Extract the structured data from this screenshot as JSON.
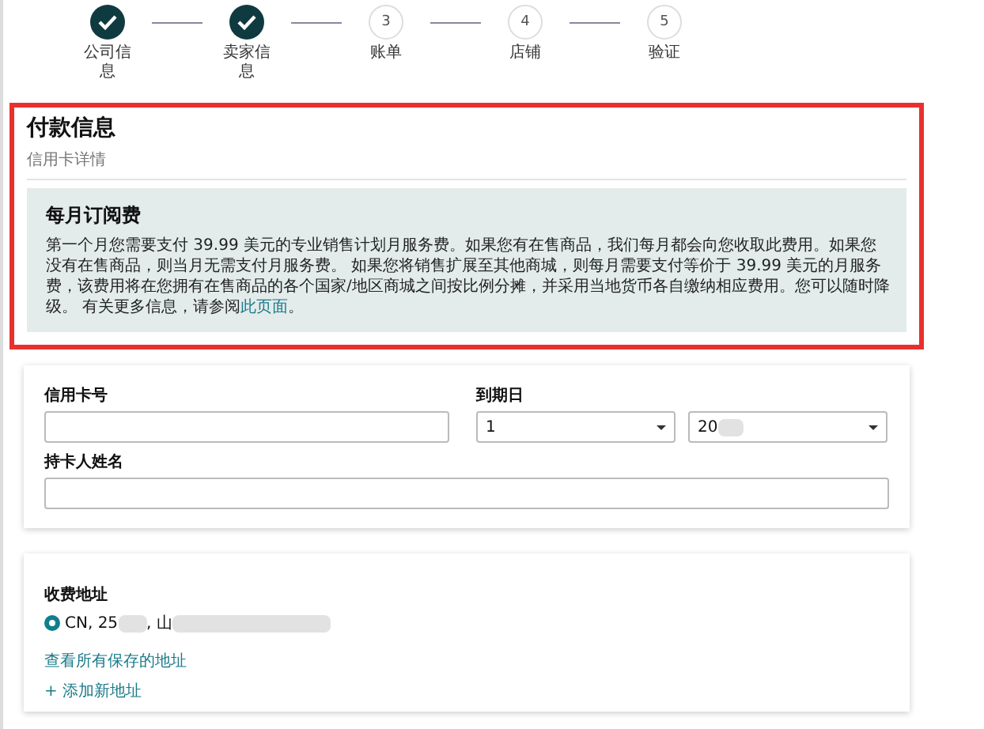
{
  "steps": [
    {
      "label": "公司信息",
      "done": true
    },
    {
      "label": "卖家信息",
      "done": true
    },
    {
      "number": "3",
      "label": "账单",
      "done": false
    },
    {
      "number": "4",
      "label": "店铺",
      "done": false
    },
    {
      "number": "5",
      "label": "验证",
      "done": false
    }
  ],
  "payment": {
    "title": "付款信息",
    "subtitle": "信用卡详情",
    "notice": {
      "title": "每月订阅费",
      "text": "第一个月您需要支付 39.99 美元的专业销售计划月服务费。如果您有在售商品，我们每月都会向您收取此费用。如果您没有在售商品，则当月无需支付月服务费。 如果您将销售扩展至其他商城，则每月需要支付等价于 39.99 美元的月服务费，该费用将在您拥有在售商品的各个国家/地区商城之间按比例分摊，并采用当地货币各自缴纳相应费用。您可以随时降级。 有关更多信息，请参阅",
      "link": "此页面",
      "end": "。"
    }
  },
  "card_form": {
    "card_number_label": "信用卡号",
    "expiry_label": "到期日",
    "month": "1",
    "year": "20",
    "holder_label": "持卡人姓名"
  },
  "billing": {
    "label": "收费地址",
    "address": {
      "selected": true,
      "parts": [
        "CN, 25",
        ", 山"
      ]
    },
    "links": [
      "查看所有保存的地址",
      "+ 添加新地址"
    ]
  }
}
